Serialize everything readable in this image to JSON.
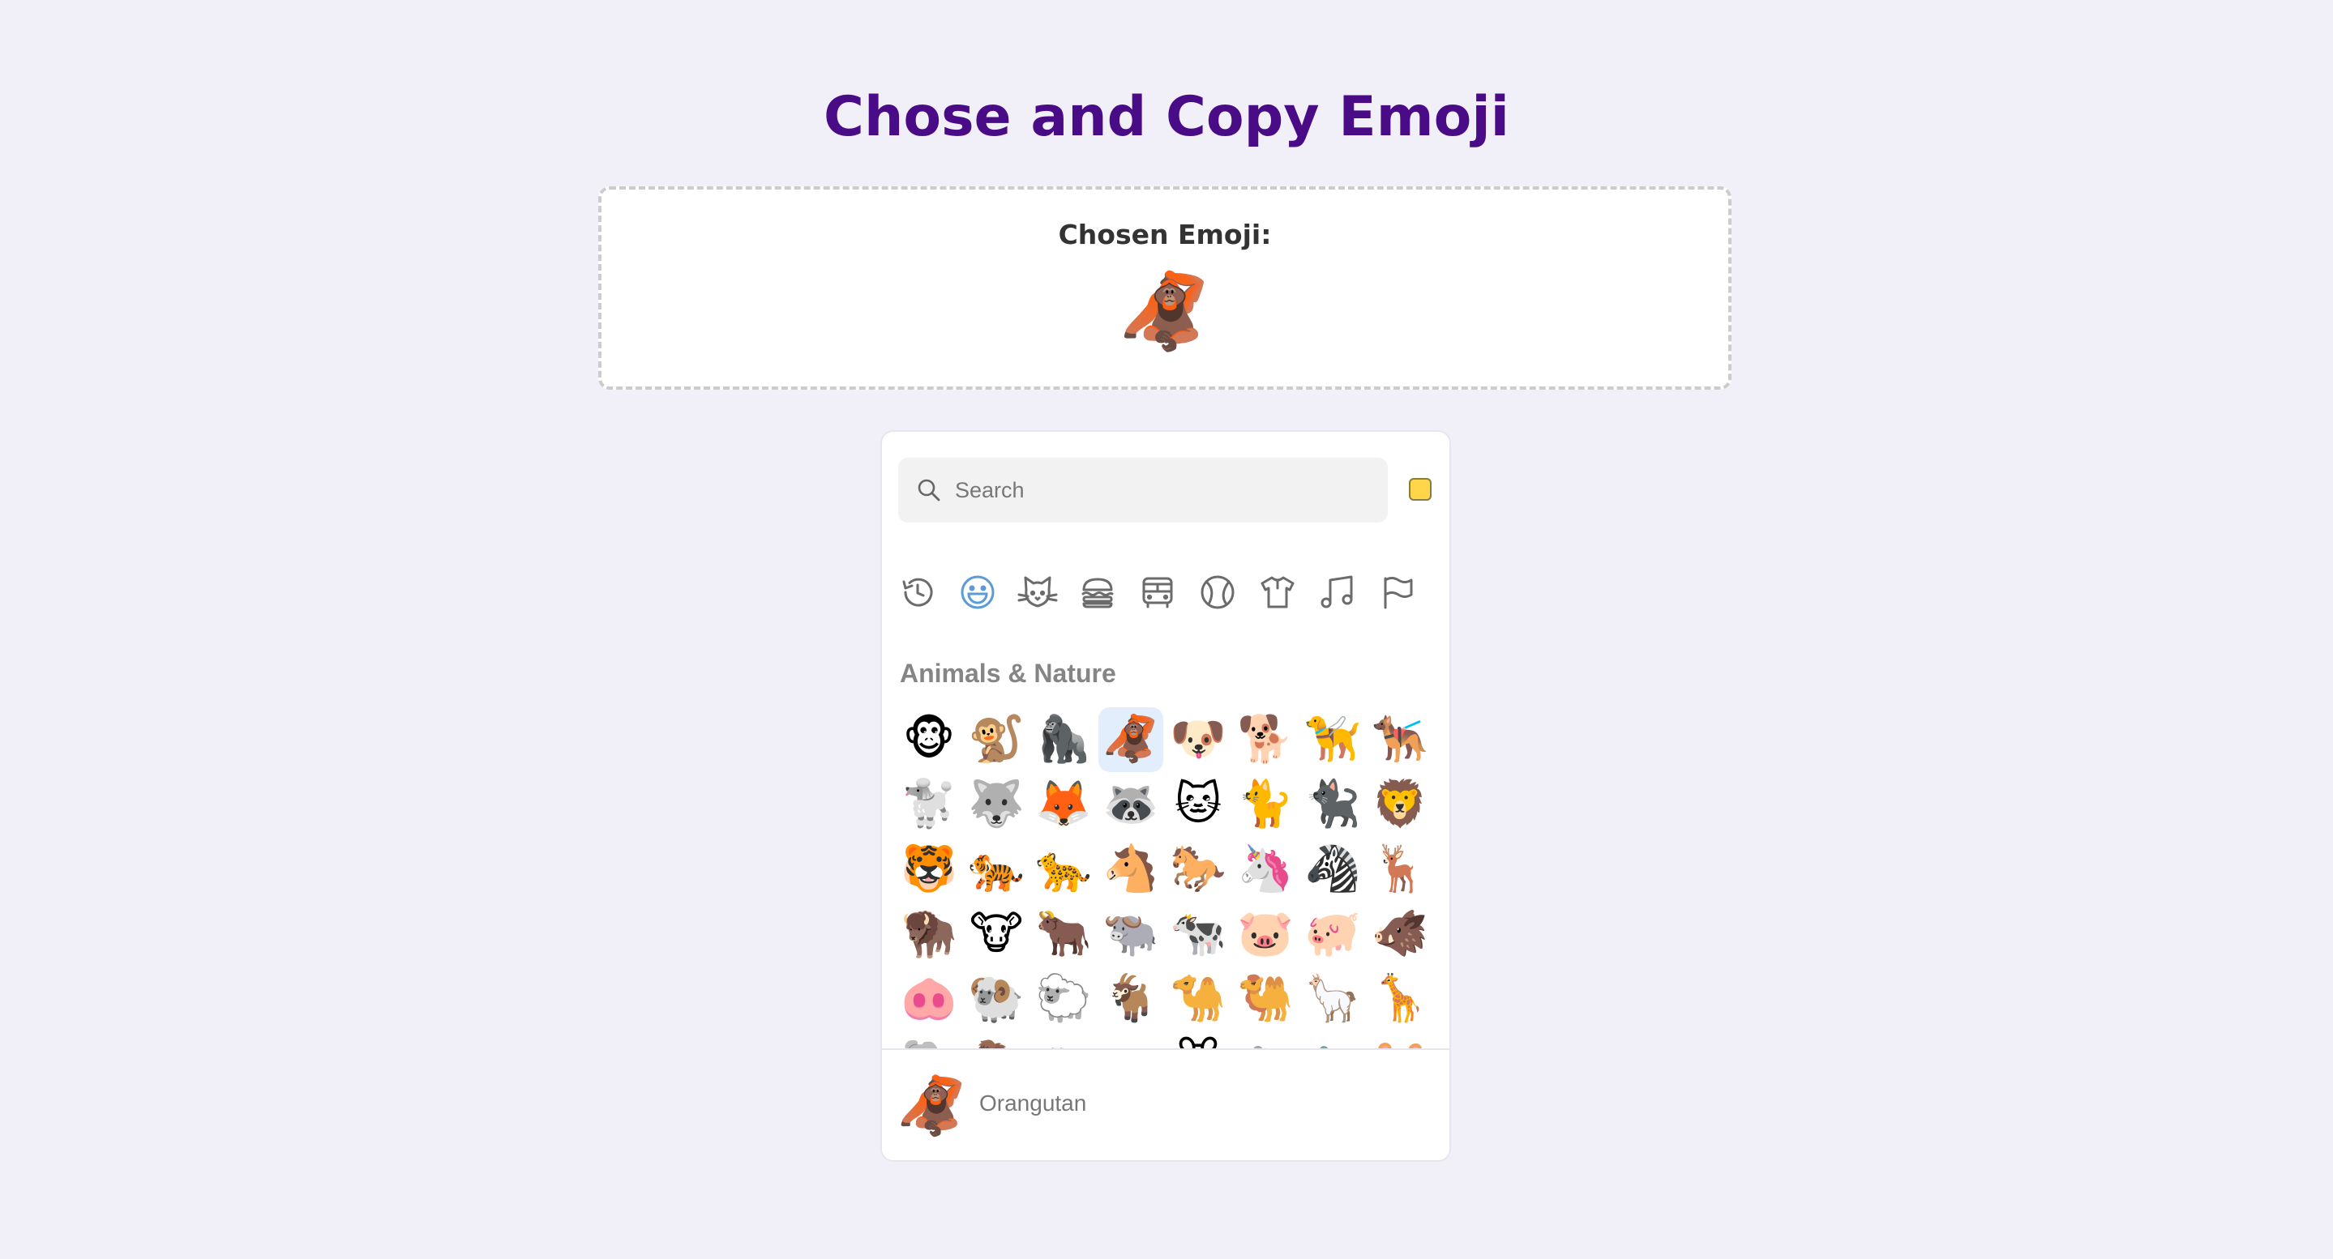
{
  "page": {
    "title": "Chose and Copy Emoji"
  },
  "chosen": {
    "label": "Chosen Emoji:",
    "emoji": "🦧"
  },
  "picker": {
    "search": {
      "placeholder": "Search",
      "value": ""
    },
    "skin_tone_color": "#ffd54a",
    "categories": [
      {
        "name": "recent",
        "icon": "clock-icon",
        "active": false
      },
      {
        "name": "smileys",
        "icon": "smiley-icon",
        "active": true
      },
      {
        "name": "animals",
        "icon": "cat-icon",
        "active": false
      },
      {
        "name": "food",
        "icon": "burger-icon",
        "active": false
      },
      {
        "name": "travel",
        "icon": "bus-icon",
        "active": false
      },
      {
        "name": "activities",
        "icon": "ball-icon",
        "active": false
      },
      {
        "name": "objects",
        "icon": "shirt-icon",
        "active": false
      },
      {
        "name": "symbols",
        "icon": "music-note-icon",
        "active": false
      },
      {
        "name": "flags",
        "icon": "flag-icon",
        "active": false
      }
    ],
    "active_category_color": "#5a9bd8",
    "section_title": "Animals & Nature",
    "emojis": [
      "🐵",
      "🐒",
      "🦍",
      "🦧",
      "🐶",
      "🐕",
      "🦮",
      "🐕‍🦺",
      "🐩",
      "🐺",
      "🦊",
      "🦝",
      "🐱",
      "🐈",
      "🐈‍⬛",
      "🦁",
      "🐯",
      "🐅",
      "🐆",
      "🐴",
      "🐎",
      "🦄",
      "🦓",
      "🦌",
      "🦬",
      "🐮",
      "🐂",
      "🐃",
      "🐄",
      "🐷",
      "🐖",
      "🐗",
      "🐽",
      "🐏",
      "🐑",
      "🐐",
      "🐪",
      "🐫",
      "🦙",
      "🦒",
      "🐘",
      "🦣",
      "🦏",
      "🦛",
      "🐭",
      "🐁",
      "🐀",
      "🐹"
    ],
    "selected_index": 3,
    "preview": {
      "emoji": "🦧",
      "name": "Orangutan"
    }
  }
}
